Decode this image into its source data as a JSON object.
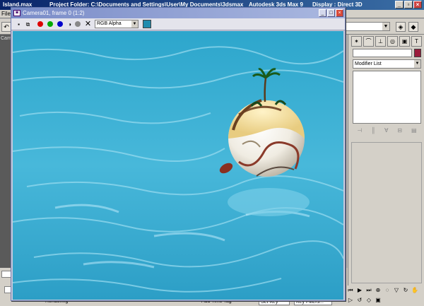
{
  "main_window": {
    "file_name": "Island.max",
    "project_folder": "Project Folder: C:\\Documents and Settings\\User\\My Documents\\3dsmax",
    "app_name": "Autodesk 3ds Max 9",
    "display": "Display : Direct 3D",
    "menu_file": "File"
  },
  "render_window": {
    "title": "Camera01, frame 0 (1:2)",
    "channel": "RGB Alpha",
    "background_color": "#1f8bae"
  },
  "viewport": {
    "label": "Cam"
  },
  "command_panel": {
    "modifier_list": "Modifier List",
    "object_color": "#9b1c3c"
  },
  "bottom": {
    "rendering_label": "Rendering",
    "add_time_tag": "Add Time Tag",
    "set_key": "Set Key",
    "key_filters": "Key Filters..."
  },
  "colors": {
    "water_light": "#5cc4e0",
    "water_dark": "#1b7ca4",
    "title_blue": "#0a246a"
  }
}
